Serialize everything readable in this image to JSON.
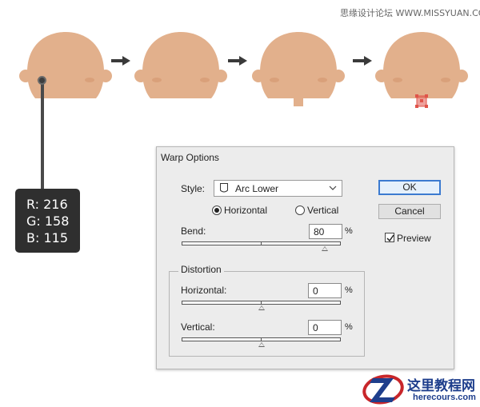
{
  "watermark": "思缘设计论坛 WWW.MISSYUAN.COM",
  "colors": {
    "skin": "#e2b08c",
    "blush": "#d9a07a",
    "callout_bg": "#2f2f2f",
    "arrow": "#3a3a3a",
    "selection": "#e0544a",
    "dialog_bg": "#ececec",
    "primary_border": "#3b7ad0",
    "logo_blue": "#1e3e8c",
    "logo_red": "#c8262a"
  },
  "callout": {
    "r": "R: 216",
    "g": "G: 158",
    "b": "B: 115"
  },
  "dialog": {
    "title": "Warp Options",
    "style_label": "Style:",
    "style_value": "Arc Lower",
    "style_icon": "arc-lower-doc-icon",
    "orientation": {
      "horizontal_label": "Horizontal",
      "vertical_label": "Vertical",
      "selected": "Horizontal"
    },
    "bend": {
      "label": "Bend:",
      "value": "80",
      "unit": "%",
      "slider_fraction": 0.9
    },
    "distortion": {
      "title": "Distortion",
      "horizontal_label": "Horizontal:",
      "horizontal_value": "0",
      "horizontal_unit": "%",
      "horizontal_fraction": 0.5,
      "vertical_label": "Vertical:",
      "vertical_value": "0",
      "vertical_unit": "%",
      "vertical_fraction": 0.5
    },
    "ok_label": "OK",
    "cancel_label": "Cancel",
    "preview_label": "Preview",
    "preview_checked": true
  },
  "logo": {
    "cn": "这里教程网",
    "en": "herecours.com"
  }
}
